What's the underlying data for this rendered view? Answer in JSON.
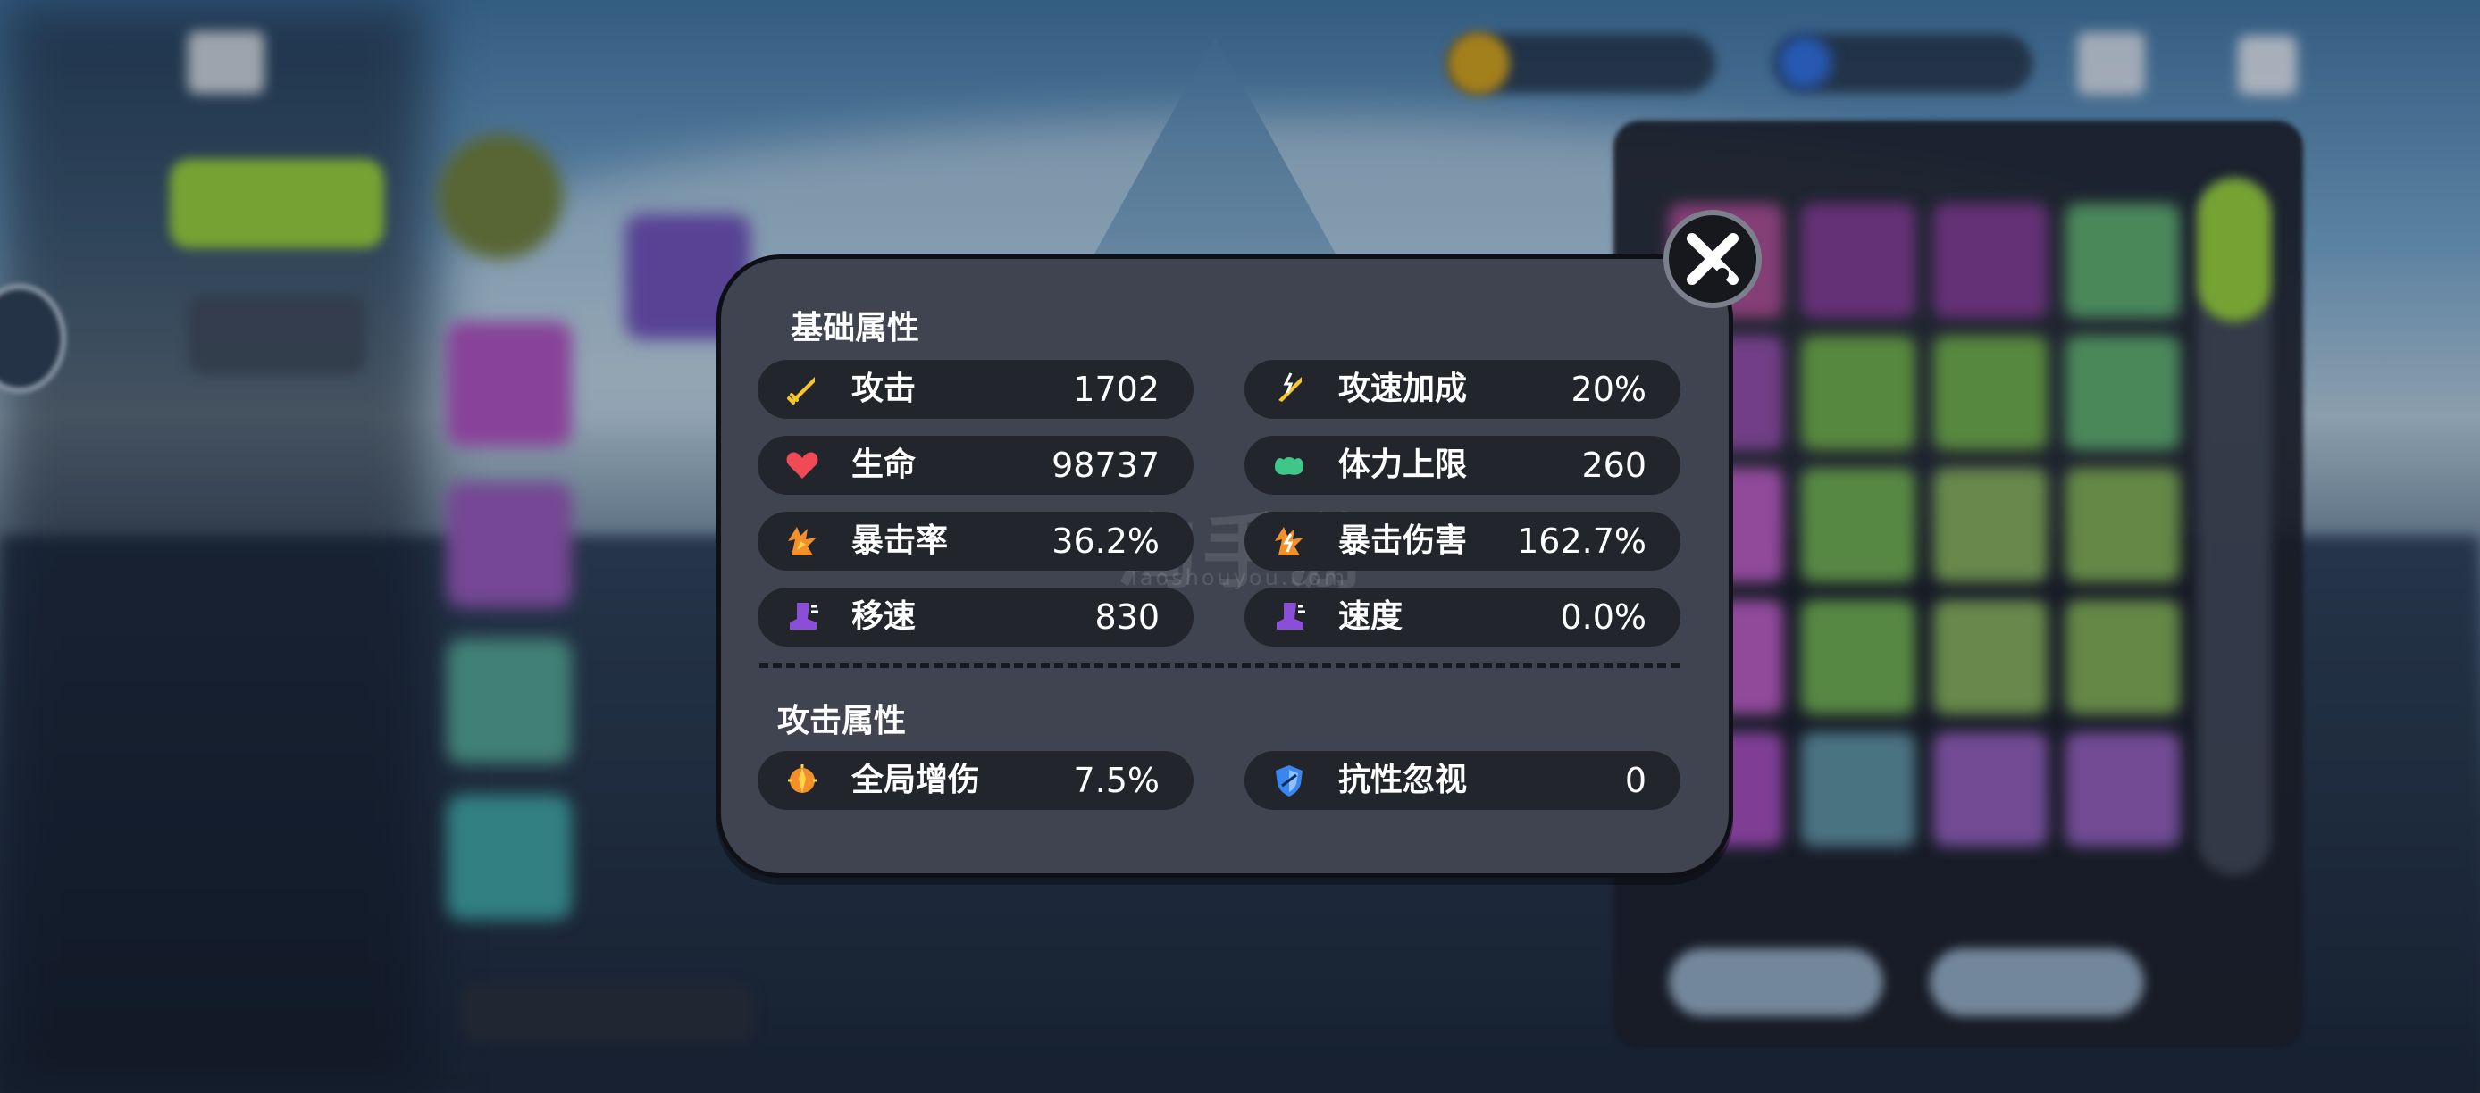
{
  "colors": {
    "modal_bg": "#404451",
    "pill_bg": "#23252d",
    "text": "#ffffff",
    "attack_icon": "#f6c62b",
    "health_icon": "#ef4a55",
    "stamina_icon": "#3fc78a",
    "crit_icon": "#f4902a",
    "speed_icon": "#8a4fd6",
    "shield_icon": "#3a86f0"
  },
  "modal": {
    "close_icon": "close-x",
    "basic_section_title": "基础属性",
    "attack_section_title": "攻击属性",
    "basic_stats": [
      {
        "label": "攻击",
        "value": "1702",
        "icon": "sword-icon"
      },
      {
        "label": "攻速加成",
        "value": "20%",
        "icon": "sword-lightning-icon"
      },
      {
        "label": "生命",
        "value": "98737",
        "icon": "heart-icon"
      },
      {
        "label": "体力上限",
        "value": "260",
        "icon": "muscle-icon"
      },
      {
        "label": "暴击率",
        "value": "36.2%",
        "icon": "burst-icon"
      },
      {
        "label": "暴击伤害",
        "value": "162.7%",
        "icon": "burst-lightning-icon"
      },
      {
        "label": "移速",
        "value": "830",
        "icon": "boot-icon"
      },
      {
        "label": "速度",
        "value": "0.0%",
        "icon": "boot-icon"
      }
    ],
    "attack_stats": [
      {
        "label": "全局增伤",
        "value": "7.5%",
        "icon": "damage-boost-icon"
      },
      {
        "label": "抗性忽视",
        "value": "0",
        "icon": "shield-icon"
      }
    ]
  },
  "watermark": {
    "main": "淘手游",
    "sub": "Taoshouyou.Com"
  }
}
